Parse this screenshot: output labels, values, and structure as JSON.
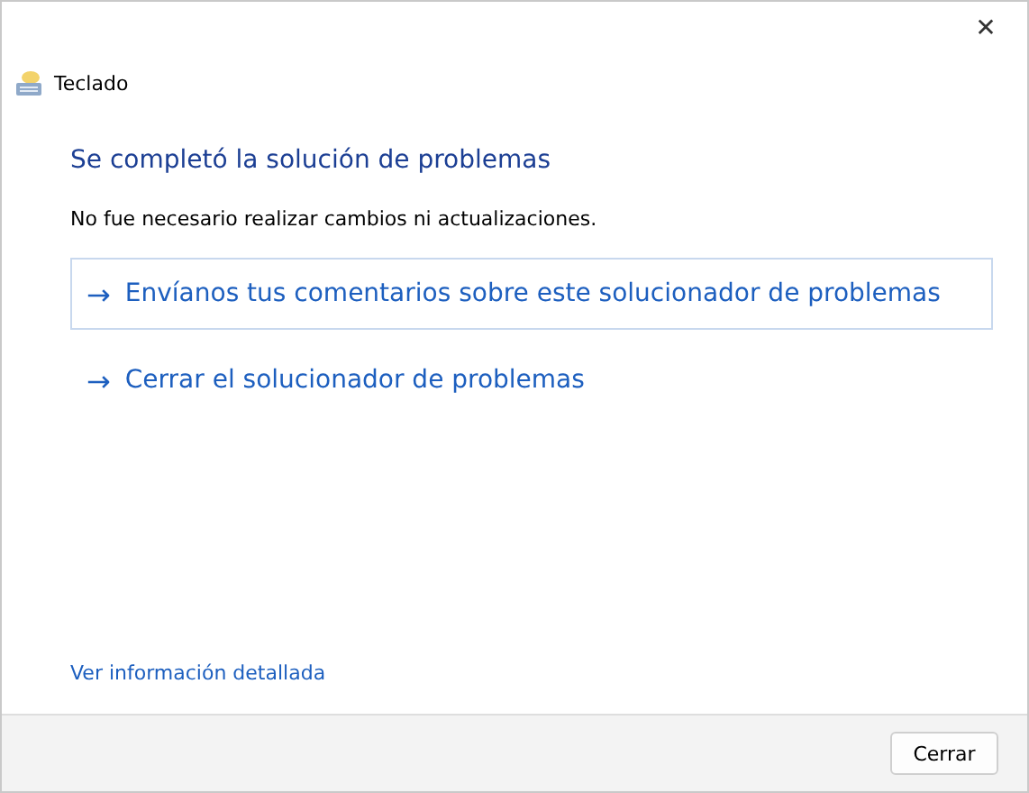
{
  "window": {
    "title": "Teclado",
    "close": "✕"
  },
  "heading": "Se completó la solución de problemas",
  "message": "No fue necesario realizar cambios ni actualizaciones.",
  "options": [
    {
      "arrow": "→",
      "label": "Envíanos tus comentarios sobre este solucionador de problemas",
      "selected": true
    },
    {
      "arrow": "→",
      "label": "Cerrar el solucionador de problemas",
      "selected": false
    }
  ],
  "details_link": "Ver información detallada",
  "buttons": [
    "Cerrar"
  ]
}
